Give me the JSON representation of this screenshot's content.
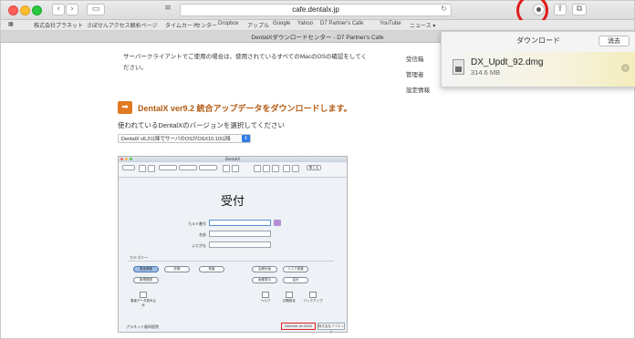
{
  "browser": {
    "url": "cafe.dentalx.jp",
    "tab_title": "DentalXダウンロードセンター - D7 Partner's Cafe",
    "bookmarks": [
      "株式会社プラネット",
      "さぼせんアクセス解析ページ",
      "タイムカード",
      "センター",
      "Dropbox",
      "アップル",
      "Google",
      "Yahoo",
      "D7 Partner's Cafe",
      "YouTube",
      "ニュース ▾"
    ]
  },
  "page": {
    "intro_line1": "サーバークライアントでご使用の場合は、使用されているすべてのMacのOSの確認をしてく",
    "intro_line2": "ださい。",
    "heading": "DentalX ver9.2 統合アップデータをダウンロードします。",
    "question": "使われているDentalXのバージョンを選択してください",
    "select_value": "DentalX v6.2以降でサーバのOSがOSX10.10以降",
    "right_links": [
      "受信箱",
      "管理者",
      "設定情報"
    ]
  },
  "app": {
    "window_title": "DentalX",
    "heading": "受付",
    "fields": [
      "カルテ番号",
      "名前",
      "ふりがな"
    ],
    "category_label": "カテゴリー",
    "toolbar_buttons": [
      "閉じる",
      "一覧",
      ""
    ],
    "category_row1": [
      "患者情報",
      "診療",
      "検査",
      "治療計画",
      "リスク検査"
    ],
    "category_row2": [
      "新規登録",
      "画像表示",
      "会計"
    ],
    "bottom_icons": [
      "ヘルプ",
      "初期設定",
      "バックアップ"
    ],
    "left_tool": "患者データ読み込み",
    "footer_left": "プラネット歯科医院",
    "version": "DentalX v6.4248",
    "version_button": "株式会社プラネット"
  },
  "downloads": {
    "title": "ダウンロード",
    "clear_label": "消去",
    "file_name": "DX_Updt_92.dmg",
    "file_size": "314.6 MB"
  },
  "colors": {
    "heading": "#b35a12",
    "highlight": "#e01b1b",
    "select_accent": "#2f7ee9"
  }
}
